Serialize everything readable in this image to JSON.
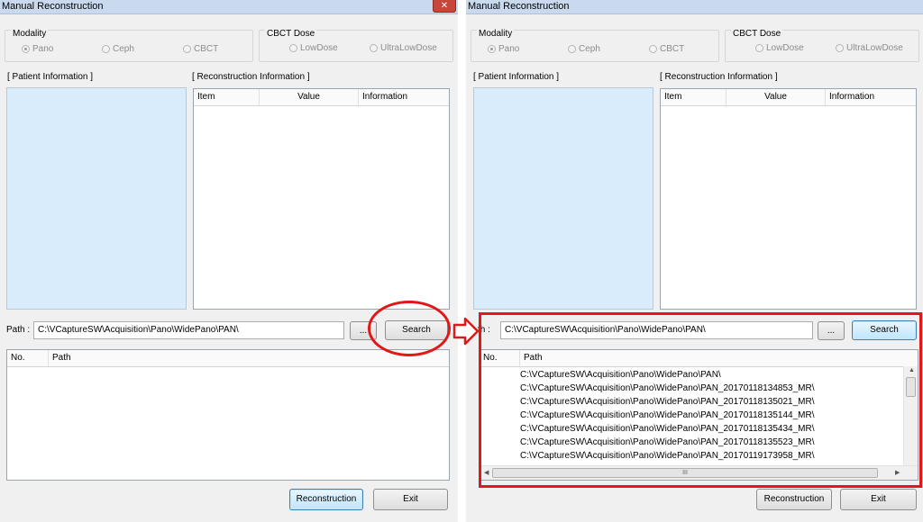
{
  "left_window": {
    "title": "Manual Reconstruction",
    "close_label": "✕",
    "modality": {
      "label": "Modality",
      "options": [
        "Pano",
        "Ceph",
        "CBCT"
      ],
      "selected": "Pano"
    },
    "cbct_dose": {
      "label": "CBCT Dose",
      "options": [
        "LowDose",
        "UltraLowDose"
      ]
    },
    "patient_info_label": "[ Patient Information ]",
    "recon_info_label": "[ Reconstruction Information ]",
    "recon_columns": [
      "Item",
      "Value",
      "Information"
    ],
    "path_label": "Path :",
    "path_value": "C:\\VCaptureSW\\Acquisition\\Pano\\WidePano\\PAN\\",
    "browse_label": "...",
    "search_label": "Search",
    "results_columns": [
      "No.",
      "Path"
    ],
    "reconstruction_label": "Reconstruction",
    "exit_label": "Exit"
  },
  "right_window": {
    "title": "Manual Reconstruction",
    "modality": {
      "label": "Modality",
      "options": [
        "Pano",
        "Ceph",
        "CBCT"
      ],
      "selected": "Pano"
    },
    "cbct_dose": {
      "label": "CBCT Dose",
      "options": [
        "LowDose",
        "UltraLowDose"
      ]
    },
    "patient_info_label": "[ Patient Information ]",
    "recon_info_label": "[ Reconstruction Information ]",
    "recon_columns": [
      "Item",
      "Value",
      "Information"
    ],
    "path_label": "th :",
    "path_value": "C:\\VCaptureSW\\Acquisition\\Pano\\WidePano\\PAN\\",
    "browse_label": "...",
    "search_label": "Search",
    "results_columns": [
      "No.",
      "Path"
    ],
    "results": [
      "C:\\VCaptureSW\\Acquisition\\Pano\\WidePano\\PAN\\",
      "C:\\VCaptureSW\\Acquisition\\Pano\\WidePano\\PAN_20170118134853_MR\\",
      "C:\\VCaptureSW\\Acquisition\\Pano\\WidePano\\PAN_20170118135021_MR\\",
      "C:\\VCaptureSW\\Acquisition\\Pano\\WidePano\\PAN_20170118135144_MR\\",
      "C:\\VCaptureSW\\Acquisition\\Pano\\WidePano\\PAN_20170118135434_MR\\",
      "C:\\VCaptureSW\\Acquisition\\Pano\\WidePano\\PAN_20170118135523_MR\\",
      "C:\\VCaptureSW\\Acquisition\\Pano\\WidePano\\PAN_20170119173958_MR\\"
    ],
    "hscroll_grip": "III",
    "reconstruction_label": "Reconstruction",
    "exit_label": "Exit"
  },
  "colors": {
    "annotation": "#e01818",
    "panel_blue": "#d9ecfb"
  },
  "icons": [
    "close-icon",
    "right-arrow-icon",
    "scroll-up-icon",
    "scroll-left-icon",
    "scroll-right-icon"
  ]
}
